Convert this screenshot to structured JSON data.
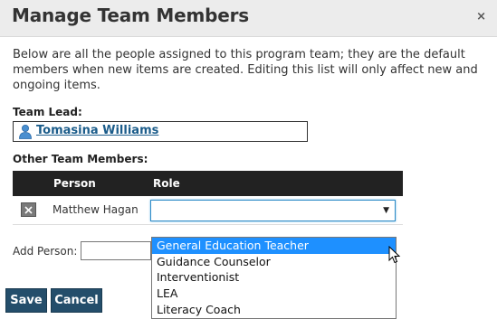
{
  "dialog": {
    "title": "Manage Team Members",
    "close_glyph": "×",
    "description": "Below are all the people assigned to this program team; they are the default members when new items are created. Editing this list will only affect new and ongoing items."
  },
  "team_lead": {
    "label": "Team Lead:",
    "name": "Tomasina Williams",
    "icon": "person-icon"
  },
  "other_members": {
    "label": "Other Team Members:",
    "columns": [
      "Person",
      "Role"
    ],
    "rows": [
      {
        "person": "Matthew Hagan",
        "role": "",
        "remove_icon": "close-icon"
      }
    ]
  },
  "add_person": {
    "label": "Add Person:",
    "value": ""
  },
  "role_dropdown": {
    "selected_index": 0,
    "options": [
      "General Education Teacher",
      "Guidance Counselor",
      "Interventionist",
      "LEA",
      "Literacy Coach"
    ]
  },
  "buttons": {
    "save": "Save",
    "cancel": "Cancel"
  },
  "colors": {
    "header_bg": "#ececec",
    "table_header_bg": "#222222",
    "button_bg": "#244e6b",
    "link": "#1b5c8a",
    "selected_option": "#1e90ff",
    "focus_border": "#2d8bc7"
  }
}
